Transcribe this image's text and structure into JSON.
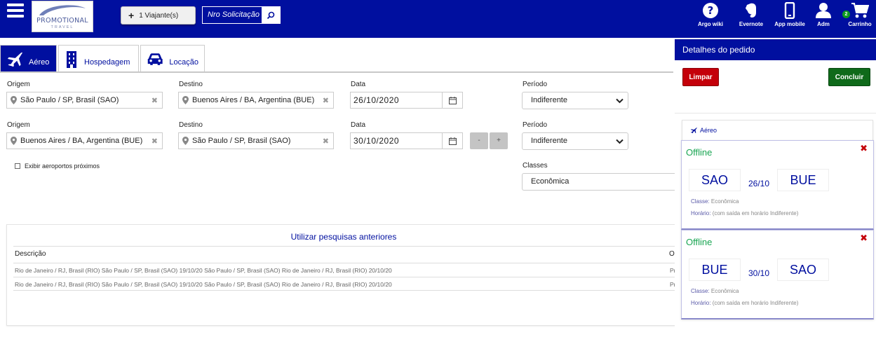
{
  "header": {
    "logo": {
      "name": "PROMOTIONAL",
      "tagline": "TRAVEL"
    },
    "travelers_label": "1 Viajante(s)",
    "solicitation_label": "Nro Solicitação",
    "icons": [
      {
        "name": "help-icon",
        "label": "Argo wiki"
      },
      {
        "name": "evernote-icon",
        "label": "Evernote"
      },
      {
        "name": "mobile-icon",
        "label": "App mobile"
      },
      {
        "name": "user-icon",
        "label": "Adm"
      },
      {
        "name": "cart-icon",
        "label": "Carrinho",
        "badge": "2"
      }
    ],
    "bg_color": "#000f9f"
  },
  "tabs": [
    {
      "label": "Aéreo",
      "icon": "plane-icon",
      "active": true
    },
    {
      "label": "Hospedagem",
      "icon": "building-icon",
      "active": false
    },
    {
      "label": "Locação",
      "icon": "car-icon",
      "active": false
    }
  ],
  "form": {
    "labels": {
      "origin": "Origem",
      "destination": "Destino",
      "date": "Data",
      "period": "Período",
      "classes": "Classes"
    },
    "rows": [
      {
        "origin": "São Paulo / SP, Brasil (SAO)",
        "destination": "Buenos Aires / BA, Argentina (BUE)",
        "date": "26/10/2020",
        "period": "Indiferente"
      },
      {
        "origin": "Buenos Aires / BA, Argentina (BUE)",
        "destination": "São Paulo / SP, Brasil (SAO)",
        "date": "30/10/2020",
        "period": "Indiferente"
      }
    ],
    "stepper": {
      "minus": "-",
      "plus": "+"
    },
    "nearby_airports_label": "Exibir aeroportos próximos",
    "class_value": "Econômica"
  },
  "previous_searches": {
    "title": "Utilizar pesquisas anteriores",
    "columns": [
      "Descrição",
      "O"
    ],
    "rows": [
      {
        "description": "Rio de Janeiro / RJ, Brasil (RIO) São Paulo / SP, Brasil (SAO) 19/10/20 São Paulo / SP, Brasil (SAO) Rio de Janeiro / RJ, Brasil (RIO) 20/10/20",
        "o": "Pr"
      },
      {
        "description": "Rio de Janeiro / RJ, Brasil (RIO) São Paulo / SP, Brasil (SAO) 19/10/20 São Paulo / SP, Brasil (SAO) Rio de Janeiro / RJ, Brasil (RIO) 20/10/20",
        "o": "Pr"
      }
    ]
  },
  "sidebar": {
    "title": "Detalhes do pedido",
    "clear_label": "Limpar",
    "finish_label": "Concluir",
    "section_label": "Aéreo",
    "flights": [
      {
        "status": "Offline",
        "from": "SAO",
        "date": "26/10",
        "to": "BUE",
        "class_key": "Classe:",
        "class_value": "Econômica",
        "time_key": "Horário:",
        "time_value": "(com saída em horário Indiferente)"
      },
      {
        "status": "Offline",
        "from": "BUE",
        "date": "30/10",
        "to": "SAO",
        "class_key": "Classe:",
        "class_value": "Econômica",
        "time_key": "Horário:",
        "time_value": "(com saída em horário Indiferente)"
      }
    ],
    "colors": {
      "clear": "#c4000a",
      "finish": "#0f6a1a",
      "status": "#19a552"
    }
  }
}
